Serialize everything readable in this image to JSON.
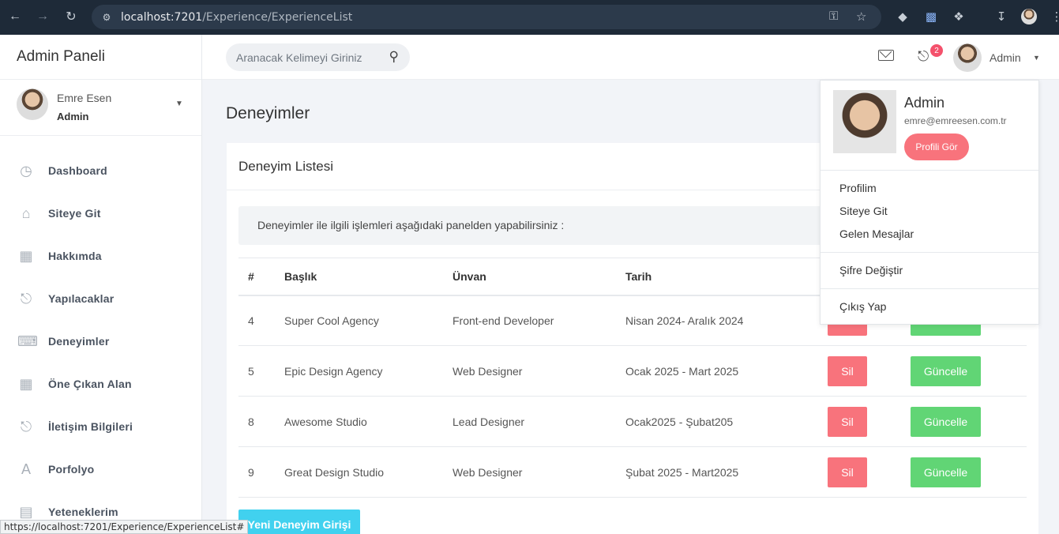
{
  "browser": {
    "url_host": "localhost:7201",
    "url_path": "/Experience/ExperienceList",
    "status_url": "https://localhost:7201/Experience/ExperienceList#"
  },
  "sidebar": {
    "brand": "Admin Paneli",
    "user": {
      "name": "Emre Esen",
      "role": "Admin"
    },
    "items": [
      {
        "label": "Dashboard",
        "icon": "dashboard-icon"
      },
      {
        "label": "Siteye Git",
        "icon": "home-icon"
      },
      {
        "label": "Hakkımda",
        "icon": "grid-icon"
      },
      {
        "label": "Yapılacaklar",
        "icon": "bell-icon"
      },
      {
        "label": "Deneyimler",
        "icon": "keyboard-icon"
      },
      {
        "label": "Öne Çıkan Alan",
        "icon": "grid-icon"
      },
      {
        "label": "İletişim Bilgileri",
        "icon": "bell-icon"
      },
      {
        "label": "Porfolyo",
        "icon": "letter-a-icon"
      },
      {
        "label": "Yeteneklerim",
        "icon": "chart-icon"
      }
    ]
  },
  "topbar": {
    "search_placeholder": "Aranacak Kelimeyi Giriniz",
    "notification_count": "2",
    "user_label": "Admin"
  },
  "page": {
    "title": "Deneyimler",
    "card_title": "Deneyim Listesi",
    "info_text": "Deneyimler ile ilgili işlemleri aşağıdaki panelden yapabilirsiniz :",
    "new_button": "Yeni Deneyim Girişi"
  },
  "table": {
    "headers": [
      "#",
      "Başlık",
      "Ünvan",
      "Tarih"
    ],
    "delete_label": "Sil",
    "update_label": "Güncelle",
    "rows": [
      {
        "id": "4",
        "title": "Super Cool Agency",
        "position": "Front-end Developer",
        "date": "Nisan 2024- Aralık 2024"
      },
      {
        "id": "5",
        "title": "Epic Design Agency",
        "position": "Web Designer",
        "date": "Ocak 2025 - Mart 2025"
      },
      {
        "id": "8",
        "title": "Awesome Studio",
        "position": "Lead Designer",
        "date": "Ocak2025 - Şubat205"
      },
      {
        "id": "9",
        "title": "Great Design Studio",
        "position": "Web Designer",
        "date": "Şubat 2025 - Mart2025"
      }
    ]
  },
  "dropdown": {
    "name": "Admin",
    "email": "emre@emreesen.com.tr",
    "profile_button": "Profili Gör",
    "items": [
      "Profilim",
      "Siteye Git",
      "Gelen Mesajlar",
      "Şifre Değiştir",
      "Çıkış Yap"
    ]
  },
  "colors": {
    "delete": "#f8737c",
    "update": "#61d575",
    "new": "#41d1ef",
    "badge": "#f4516c"
  }
}
